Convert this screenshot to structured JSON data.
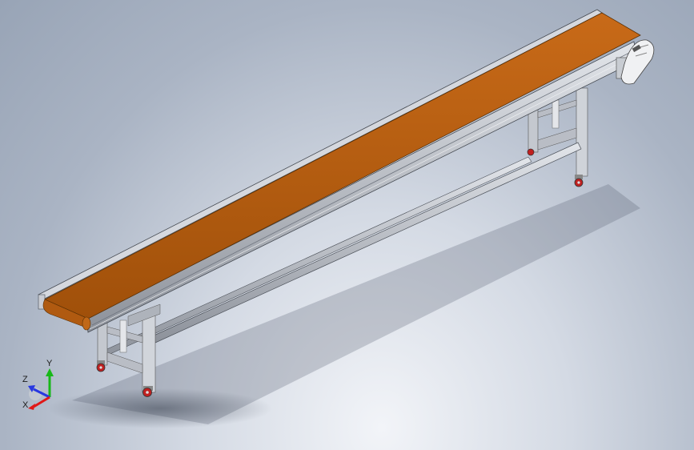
{
  "viewport": {
    "background_top": "#98a4b6",
    "background_bottom": "#eef1f6"
  },
  "model": {
    "belt_color": "#b4590c",
    "frame_color": "#b8bcc4",
    "caster_color": "#c02020"
  },
  "triad": {
    "x_label": "X",
    "y_label": "Y",
    "z_label": "Z",
    "x_color": "#e01818",
    "y_color": "#18b818",
    "z_color": "#2838e0"
  }
}
